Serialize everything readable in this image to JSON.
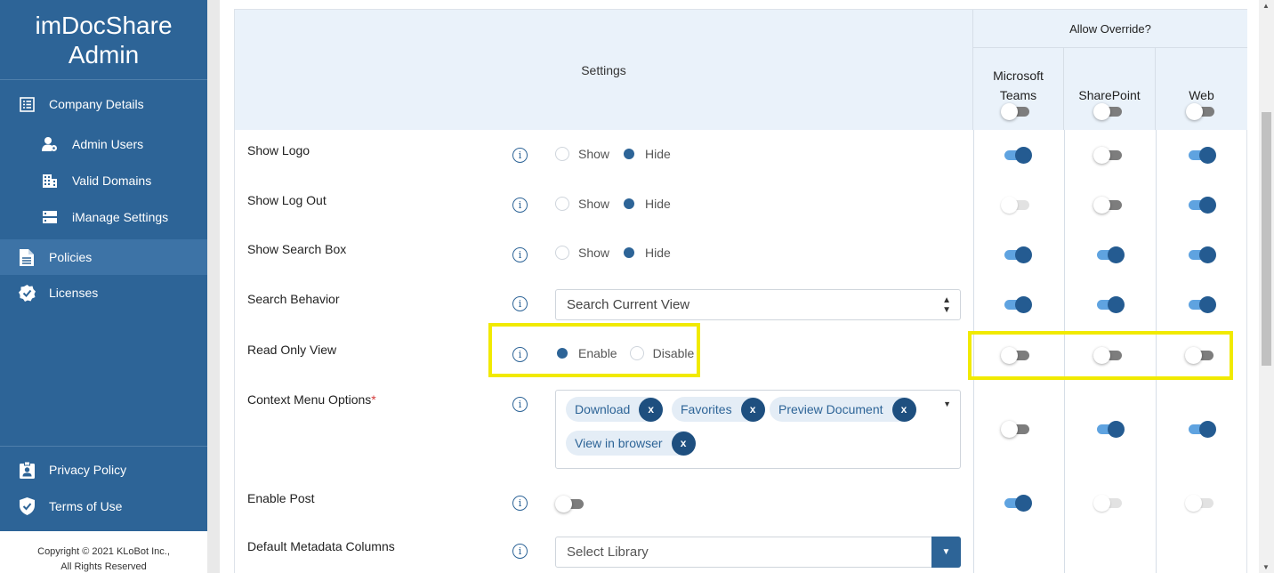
{
  "sidebar": {
    "brand_line1": "imDocShare",
    "brand_line2": "Admin",
    "items": [
      {
        "label": "Company Details",
        "icon": "list-icon"
      },
      {
        "label": "Admin Users",
        "icon": "user-gear-icon"
      },
      {
        "label": "Valid Domains",
        "icon": "building-icon"
      },
      {
        "label": "iManage Settings",
        "icon": "server-icon"
      },
      {
        "label": "Policies",
        "icon": "document-icon",
        "active": true
      },
      {
        "label": "Licenses",
        "icon": "badge-check-icon"
      },
      {
        "label": "Privacy Policy",
        "icon": "id-badge-icon"
      },
      {
        "label": "Terms of Use",
        "icon": "shield-check-icon"
      }
    ],
    "copyright_line1": "Copyright © 2021 KLoBot Inc.,",
    "copyright_line2": "All Rights Reserved"
  },
  "table": {
    "settings_header": "Settings",
    "allow_override_header": "Allow Override?",
    "columns": [
      {
        "label_line1": "Microsoft",
        "label_line2": "Teams",
        "toggle": "off"
      },
      {
        "label_line1": "",
        "label_line2": "SharePoint",
        "toggle": "off"
      },
      {
        "label_line1": "",
        "label_line2": "Web",
        "toggle": "off"
      }
    ],
    "rows": [
      {
        "label": "Show Logo",
        "radio": [
          "Show",
          "Hide"
        ],
        "selected": "Hide",
        "toggles": [
          "on",
          "off",
          "on"
        ]
      },
      {
        "label": "Show Log Out",
        "radio": [
          "Show",
          "Hide"
        ],
        "selected": "Hide",
        "toggles": [
          "disabled",
          "off",
          "on"
        ]
      },
      {
        "label": "Show Search Box",
        "radio": [
          "Show",
          "Hide"
        ],
        "selected": "Hide",
        "toggles": [
          "on",
          "on",
          "on"
        ]
      },
      {
        "label": "Search Behavior",
        "select_value": "Search Current View",
        "toggles": [
          "on",
          "on",
          "on"
        ]
      },
      {
        "label": "Read Only View",
        "radio": [
          "Enable",
          "Disable"
        ],
        "selected": "Enable",
        "toggles": [
          "off",
          "off",
          "off"
        ]
      },
      {
        "label": "Context Menu Options",
        "required_mark": "*",
        "chips": [
          "Download",
          "Favorites",
          "Preview Document",
          "View in browser"
        ],
        "chip_remove": "x",
        "toggles": [
          "off",
          "on",
          "on"
        ]
      },
      {
        "label": "Enable Post",
        "toggle_value": "off",
        "toggles": [
          "on",
          "disabled",
          "disabled"
        ]
      },
      {
        "label": "Default Metadata Columns",
        "select_placeholder": "Select Library"
      }
    ],
    "info_glyph": "i"
  },
  "colors": {
    "sidebar_bg": "#2d6497",
    "header_bg": "#eaf2fa",
    "toggle_on": "#245b91",
    "highlight": "#f1ea00"
  }
}
